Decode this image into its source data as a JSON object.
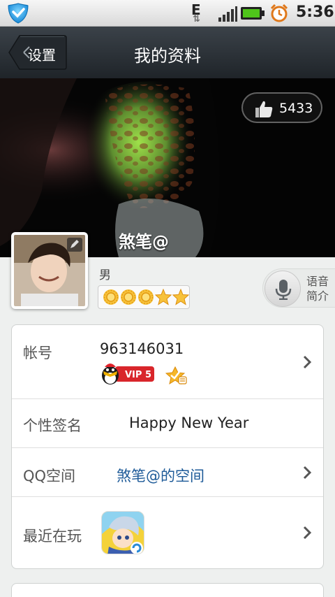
{
  "status_bar": {
    "network": "E",
    "time": "5:36"
  },
  "title_bar": {
    "back_label": "设置",
    "title": "我的资料"
  },
  "cover": {
    "likes": "5433",
    "nickname": "煞笔@"
  },
  "profile": {
    "gender": "男",
    "voice_intro": [
      "语音",
      "简介"
    ]
  },
  "info": {
    "account_label": "帐号",
    "account_value": "963146031",
    "vip_label": "VIP 5",
    "signature_label": "个性签名",
    "signature_value": "Happy New Year",
    "qzone_label": "QQ空间",
    "qzone_value": "煞笔@的空间",
    "recent_label": "最近在玩"
  },
  "colors": {
    "title_bar": "#2c3238",
    "link": "#1d5a98",
    "vip": "#d9262b"
  },
  "icons": [
    "app-shield-icon",
    "signal-icon",
    "battery-icon",
    "alarm-icon",
    "thumbs-up-icon",
    "edit-pencil-icon",
    "sun-level-icon",
    "star-level-icon",
    "microphone-icon",
    "penguin-icon",
    "qzone-badge-icon",
    "chevron-right-icon",
    "game-icon"
  ]
}
